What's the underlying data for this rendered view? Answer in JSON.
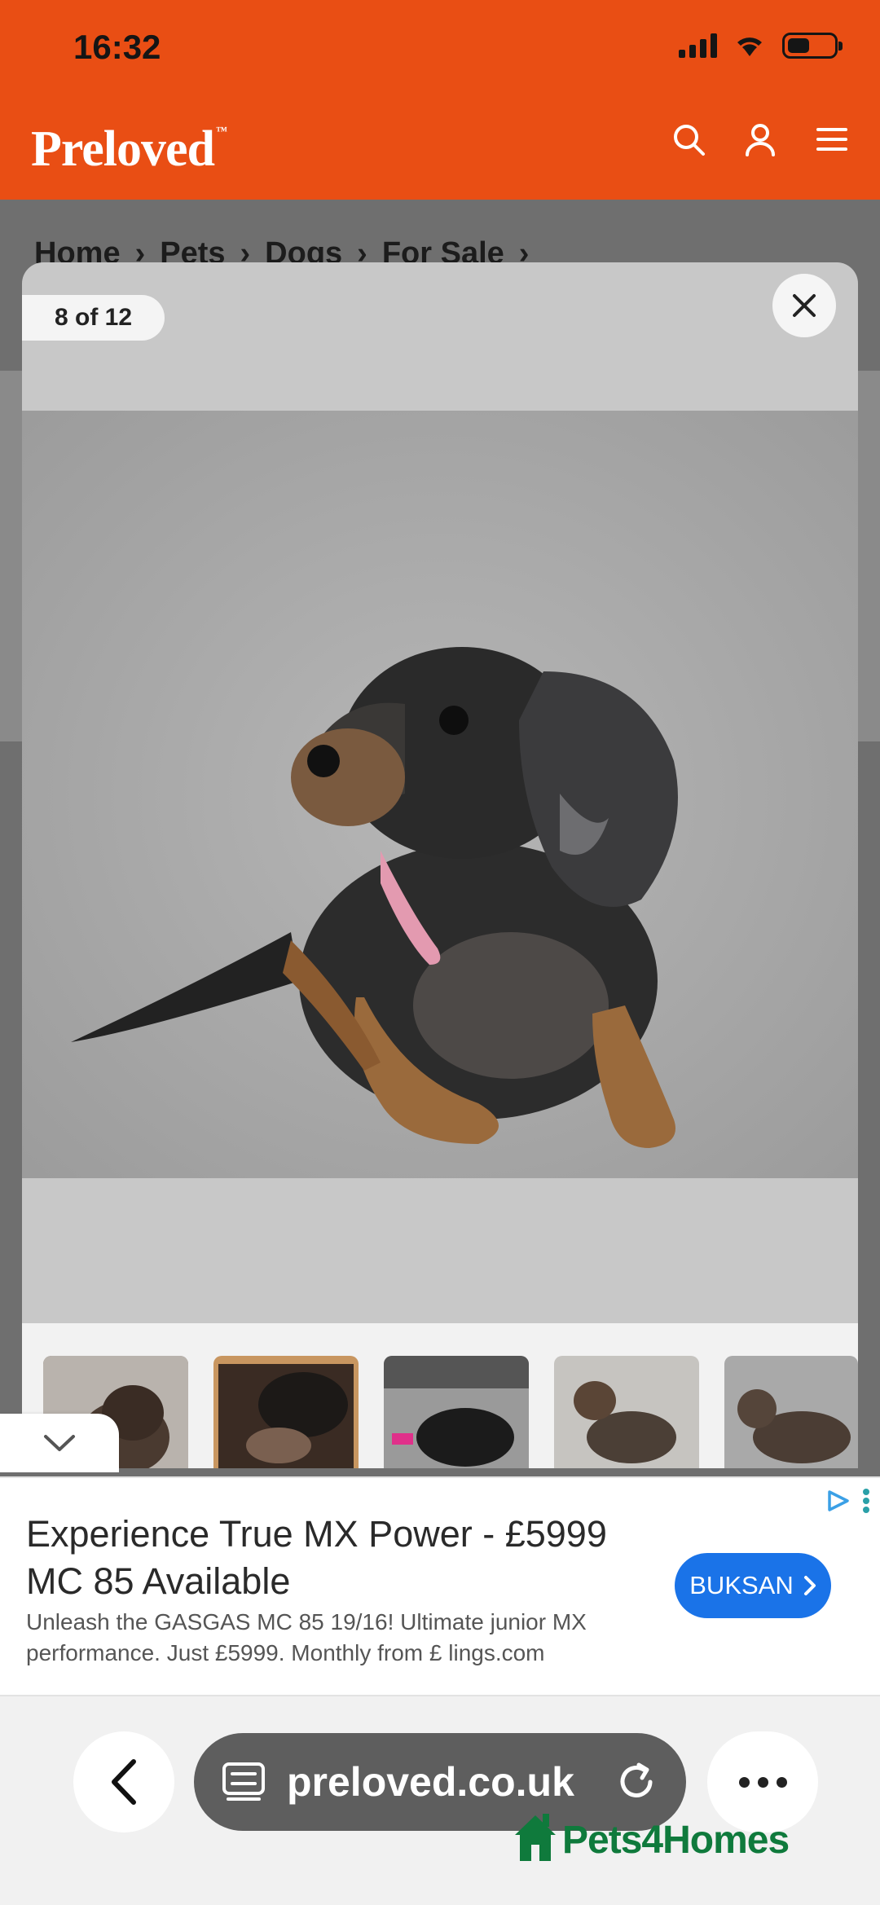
{
  "status_bar": {
    "time": "16:32"
  },
  "header": {
    "logo_text": "Preloved",
    "logo_mark": "™",
    "icons": [
      "search-icon",
      "user-icon",
      "menu-icon"
    ],
    "bg_color": "#e94e14"
  },
  "breadcrumb": {
    "items": [
      "Home",
      "Pets",
      "Dogs",
      "For Sale"
    ],
    "separator": "›"
  },
  "gallery": {
    "counter": "8 of 12",
    "current_index": 8,
    "total": 12,
    "close_icon": "close-icon",
    "thumbnails_visible": 5
  },
  "ad": {
    "title": "Experience True MX Power - £5999 MC 85 Available",
    "description": "Unleash the GASGAS MC 85 19/16! Ultimate junior MX performance. Just £5999. Monthly from £ lings.com",
    "cta_label": "BUKSAN",
    "cta_color": "#1a73e8",
    "collapse_icon": "chevron-down-icon"
  },
  "browser": {
    "url": "preloved.co.uk",
    "back_icon": "chevron-left-icon",
    "reload_icon": "reload-icon",
    "more_icon": "more-dots-icon"
  },
  "brand_watermark": {
    "text": "Pets4Homes",
    "color": "#0f7a3c"
  }
}
